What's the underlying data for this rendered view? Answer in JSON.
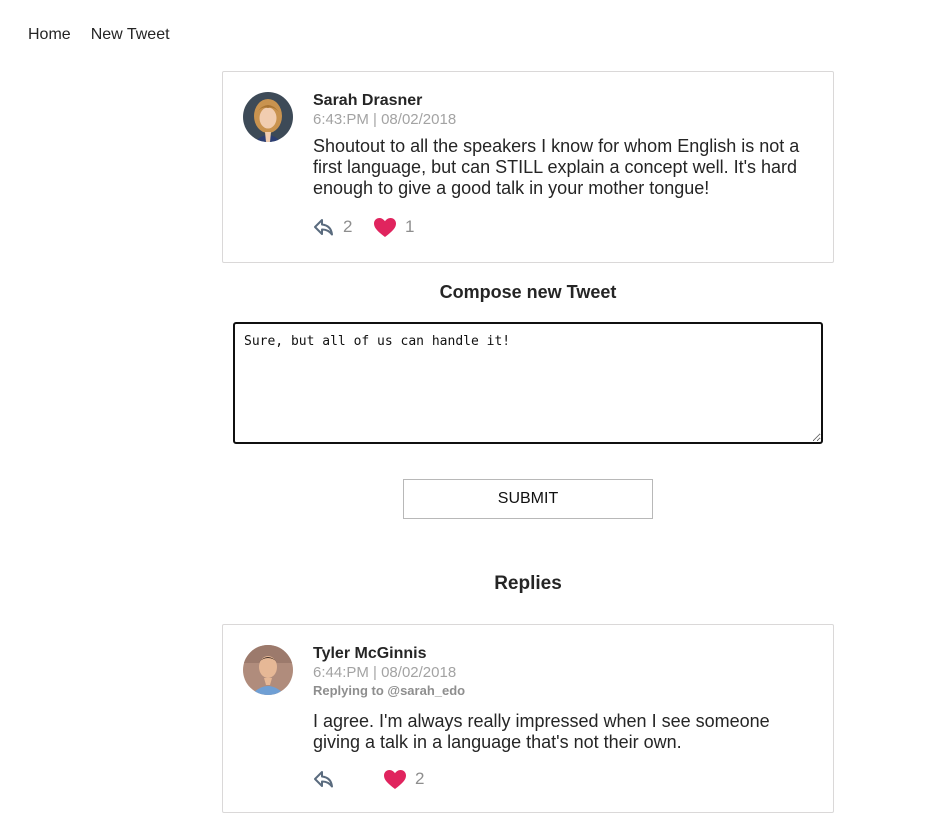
{
  "nav": {
    "home_label": "Home",
    "new_tweet_label": "New Tweet"
  },
  "main_tweet": {
    "author": "Sarah Drasner",
    "timestamp": "6:43:PM | 08/02/2018",
    "text": "Shoutout to all the speakers I know for whom English is not a first language, but can STILL explain a concept well. It's hard enough to give a good talk in your mother tongue!",
    "replies_count": "2",
    "likes_count": "1",
    "liked": true
  },
  "compose": {
    "title": "Compose new Tweet",
    "value": "Sure, but all of us can handle it!",
    "submit_label": "SUBMIT"
  },
  "replies_section": {
    "title": "Replies"
  },
  "reply_tweet": {
    "author": "Tyler McGinnis",
    "timestamp": "6:44:PM | 08/02/2018",
    "replying_to": "Replying to @sarah_edo",
    "text": "I agree. I'm always really impressed when I see someone giving a talk in a language that's not their own.",
    "replies_count": "",
    "likes_count": "2",
    "liked": true
  },
  "colors": {
    "heart": "#e0245e",
    "reply_icon": "#5a6b7e",
    "muted_text": "#a3a3a3",
    "border": "#dad8d8"
  },
  "icons": {
    "reply": "reply-arrow-icon",
    "like": "heart-icon"
  }
}
